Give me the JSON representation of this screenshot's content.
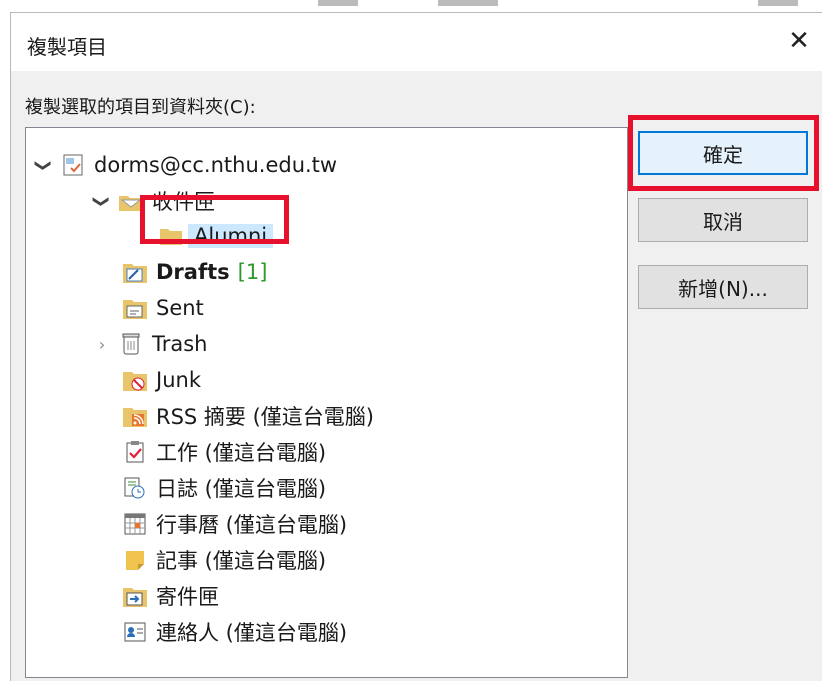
{
  "dialog": {
    "title": "複製項目",
    "close_glyph": "✕",
    "prompt": "複製選取的項目到資料夾(C):"
  },
  "tree": {
    "account": {
      "label": "dorms@cc.nthu.edu.tw",
      "icon": "mailbox-account-icon"
    },
    "inbox": {
      "label": "收件匣",
      "icon": "inbox-folder-icon"
    },
    "alumni": {
      "label": "Alumni",
      "icon": "folder-icon",
      "selected": true
    },
    "drafts": {
      "label": "Drafts",
      "count": "[1]",
      "icon": "drafts-folder-icon"
    },
    "sent": {
      "label": "Sent",
      "icon": "sent-folder-icon"
    },
    "trash": {
      "label": "Trash",
      "icon": "trash-icon"
    },
    "junk": {
      "label": "Junk",
      "icon": "junk-folder-icon"
    },
    "rss": {
      "label": "RSS 摘要 (僅這台電腦)",
      "icon": "rss-folder-icon"
    },
    "tasks": {
      "label": "工作 (僅這台電腦)",
      "icon": "tasks-icon"
    },
    "journal": {
      "label": "日誌 (僅這台電腦)",
      "icon": "journal-icon"
    },
    "calendar": {
      "label": "行事曆 (僅這台電腦)",
      "icon": "calendar-icon"
    },
    "notes": {
      "label": "記事 (僅這台電腦)",
      "icon": "notes-icon"
    },
    "outbox": {
      "label": "寄件匣",
      "icon": "outbox-folder-icon"
    },
    "contacts": {
      "label": "連絡人 (僅這台電腦)",
      "icon": "contacts-icon"
    }
  },
  "buttons": {
    "ok": "確定",
    "cancel": "取消",
    "new": "新增(N)..."
  },
  "colors": {
    "highlight_box": "#e8112d",
    "selection": "#cce8ff",
    "default_button_border": "#0078d7",
    "unread_count": "#2e9a2e"
  }
}
